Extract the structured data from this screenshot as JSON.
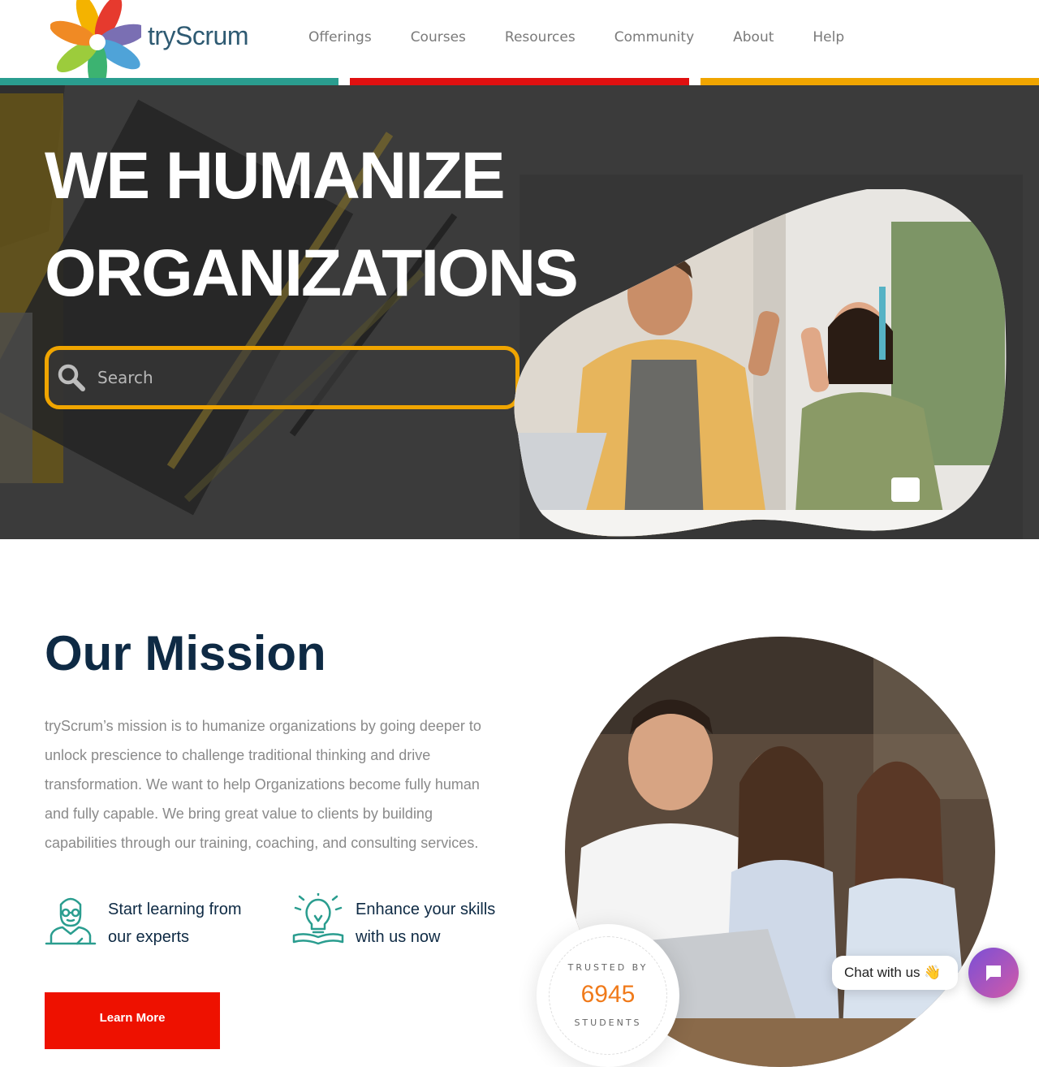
{
  "header": {
    "logo_text": "tryScrum",
    "nav": [
      "Offerings",
      "Courses",
      "Resources",
      "Community",
      "About",
      "Help"
    ]
  },
  "colors": {
    "stripe_teal": "#2a9d8f",
    "stripe_red": "#e01010",
    "stripe_orange": "#f0a500",
    "title_navy": "#0e2a44",
    "button_red": "#ee1100",
    "counter_orange": "#f07a1a"
  },
  "hero": {
    "title_line1": "WE HUMANIZE",
    "title_line2": "ORGANIZATIONS",
    "search_placeholder": "Search",
    "search_icon": "search-icon"
  },
  "mission": {
    "title": "Our Mission",
    "text": "tryScrum’s mission is to humanize organizations by going deeper to unlock prescience to challenge traditional thinking and drive transformation. We want to help Organizations become fully human and fully capable. We bring great value to clients by building capabilities through our training, coaching, and consulting services.",
    "features": [
      {
        "icon": "expert-teacher-icon",
        "label": "Start learning from our experts"
      },
      {
        "icon": "lightbulb-book-icon",
        "label": "Enhance your skills with us now"
      }
    ],
    "button_label": "Learn More"
  },
  "trusted": {
    "top": "TRUSTED BY",
    "count": "6945",
    "bottom": "STUDENTS"
  },
  "chat": {
    "label": "Chat with us 👋",
    "button_icon": "chat-icon"
  }
}
